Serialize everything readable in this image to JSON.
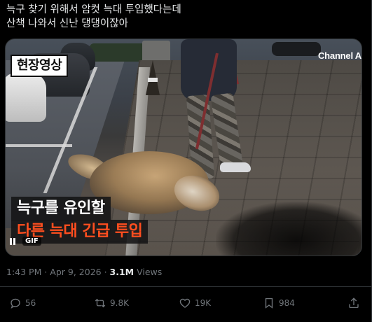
{
  "tweet": {
    "text_lines": [
      "늑구 찾기 위해서 암컷 늑대 투입했다는데",
      "산책 나와서 신난 댕댕이잖아"
    ]
  },
  "media": {
    "badge": "현장영상",
    "brand": "Channel A",
    "caption_line1": "늑구를 유인할",
    "caption_line2": "다른 늑대 긴급 투입",
    "gif_label": "GIF",
    "caption_line2_color": "#ff4e1f"
  },
  "meta": {
    "time": "1:43 PM",
    "separator1": " · ",
    "date": "Apr 9, 2026",
    "separator2": " · ",
    "views_count": "3.1M",
    "views_label": " Views"
  },
  "actions": {
    "replies": "56",
    "reposts": "9.8K",
    "likes": "19K",
    "bookmarks": "984"
  },
  "icons": {
    "reply": "reply-icon",
    "repost": "repost-icon",
    "like": "heart-icon",
    "bookmark": "bookmark-icon",
    "share": "share-icon",
    "pause": "pause-icon"
  }
}
